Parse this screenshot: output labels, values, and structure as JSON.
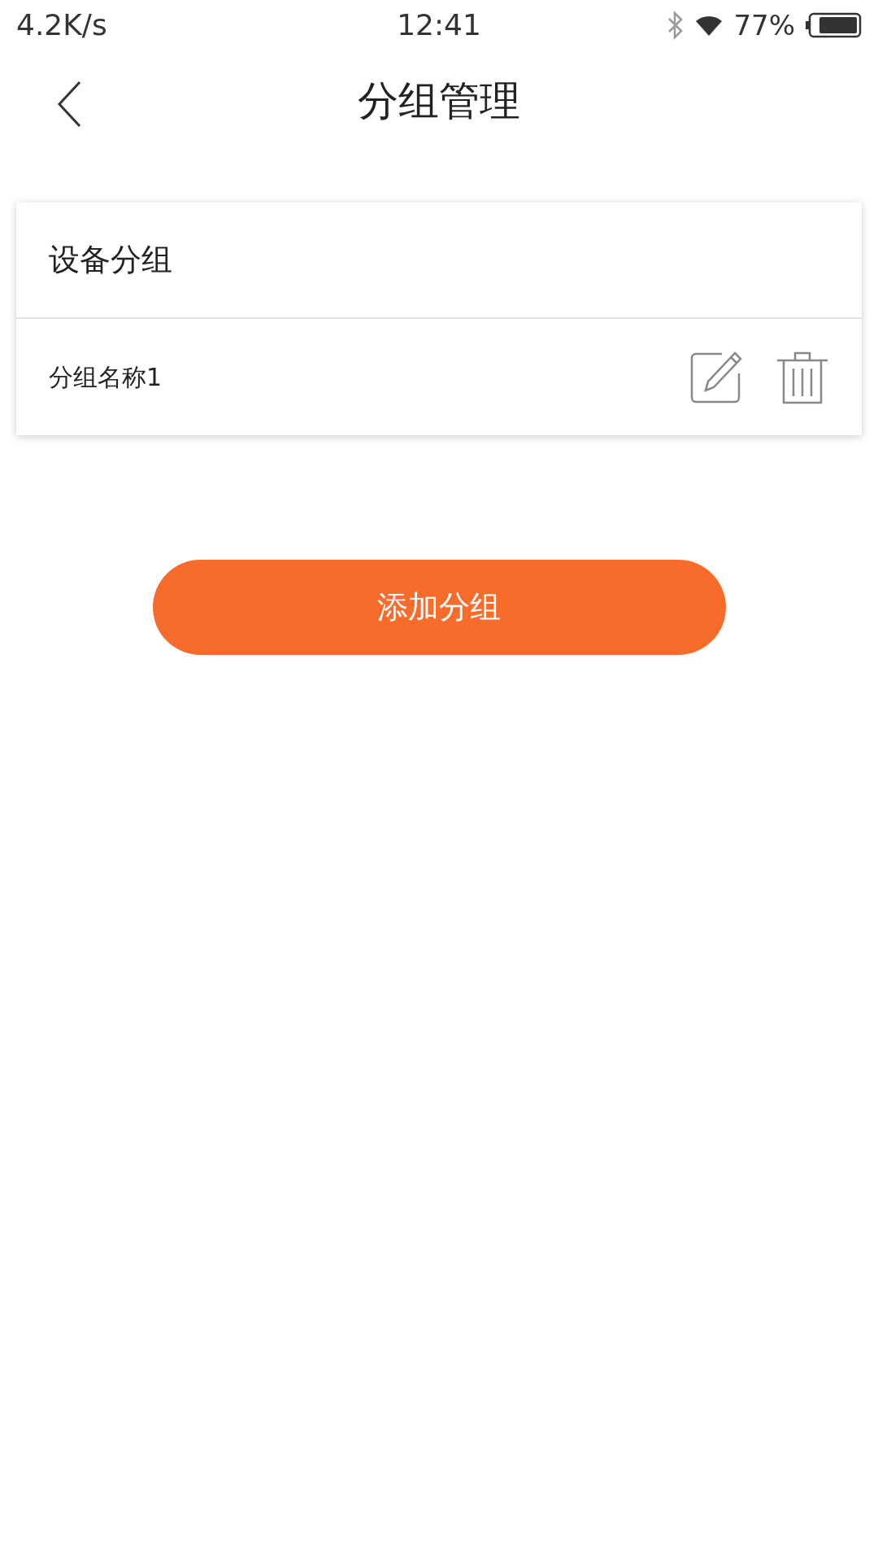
{
  "status_bar": {
    "speed": "4.2K/s",
    "time": "12:41",
    "battery": "77%"
  },
  "header": {
    "title": "分组管理"
  },
  "card": {
    "title": "设备分组",
    "groups": [
      {
        "name": "分组名称1"
      }
    ]
  },
  "add_button": "添加分组"
}
